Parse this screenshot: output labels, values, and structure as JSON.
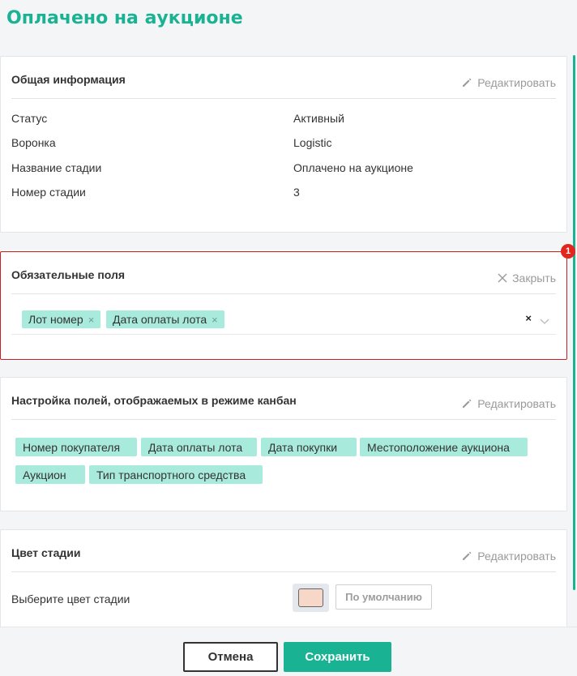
{
  "page": {
    "title": "Оплачено на аукционе"
  },
  "general": {
    "title": "Общая информация",
    "edit_label": "Редактировать",
    "rows": [
      {
        "label": "Статус",
        "value": "Активный"
      },
      {
        "label": "Воронка",
        "value": "Logistic"
      },
      {
        "label": "Название стадии",
        "value": "Оплачено на аукционе"
      },
      {
        "label": "Номер стадии",
        "value": "3"
      }
    ]
  },
  "required": {
    "title": "Обязательные поля",
    "close_label": "Закрыть",
    "badge": "1",
    "tags": [
      "Лот номер",
      "Дата оплаты лота"
    ],
    "tag_remove": "×",
    "clear": "×"
  },
  "kanban": {
    "title": "Настройка полей, отображаемых в режиме канбан",
    "edit_label": "Редактировать",
    "chips": [
      "Номер покупателя",
      "Дата оплаты лота",
      "Дата покупки",
      "Местоположение аукциона",
      "Аукцион",
      "Тип транспортного средства"
    ]
  },
  "color": {
    "title": "Цвет стадии",
    "edit_label": "Редактировать",
    "label": "Выберите цвет стадии",
    "swatch": "#f7d8c8",
    "default_label": "По умолчанию"
  },
  "footer": {
    "cancel": "Отмена",
    "save": "Сохранить"
  },
  "colors": {
    "accent": "#19b394",
    "tag_bg": "#a8eadb",
    "error": "#cc1f1f"
  },
  "icons": {
    "edit": "pencil-icon",
    "close": "close-icon",
    "dropdown": "chevron-down-icon"
  }
}
